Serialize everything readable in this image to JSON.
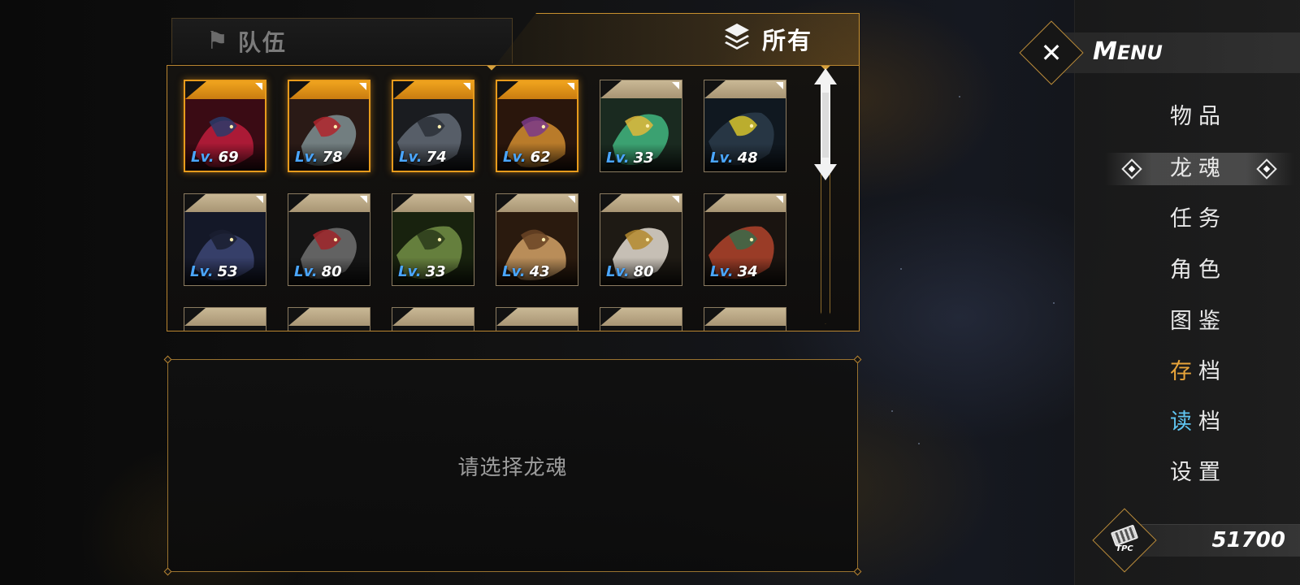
{
  "tabs": {
    "team_label": "队伍",
    "all_label": "所有"
  },
  "dragon_souls": [
    {
      "level_prefix": "Lv.",
      "level": "69",
      "selected": true,
      "colors": [
        "#3a0b14",
        "#b81c3a",
        "#2a3b6a"
      ]
    },
    {
      "level_prefix": "Lv.",
      "level": "78",
      "selected": true,
      "colors": [
        "#2a1a16",
        "#7a8a8c",
        "#b0242c"
      ]
    },
    {
      "level_prefix": "Lv.",
      "level": "74",
      "selected": true,
      "colors": [
        "#1a1c20",
        "#5e6670",
        "#2c3038"
      ]
    },
    {
      "level_prefix": "Lv.",
      "level": "62",
      "selected": true,
      "colors": [
        "#2a160c",
        "#c9862e",
        "#7a3a8a"
      ]
    },
    {
      "level_prefix": "Lv.",
      "level": "33",
      "selected": false,
      "colors": [
        "#1a2a20",
        "#3fae7a",
        "#e2b83a"
      ]
    },
    {
      "level_prefix": "Lv.",
      "level": "48",
      "selected": false,
      "colors": [
        "#101820",
        "#2a3a48",
        "#d6c22a"
      ]
    },
    {
      "level_prefix": "Lv.",
      "level": "53",
      "selected": false,
      "colors": [
        "#141828",
        "#3a4470",
        "#1a1e30"
      ]
    },
    {
      "level_prefix": "Lv.",
      "level": "80",
      "selected": false,
      "colors": [
        "#151515",
        "#6a6a6a",
        "#a0262a"
      ]
    },
    {
      "level_prefix": "Lv.",
      "level": "33",
      "selected": false,
      "colors": [
        "#18220e",
        "#6e8a42",
        "#2a3a1a"
      ]
    },
    {
      "level_prefix": "Lv.",
      "level": "43",
      "selected": false,
      "colors": [
        "#2a1a0e",
        "#c99a62",
        "#6a4424"
      ]
    },
    {
      "level_prefix": "Lv.",
      "level": "80",
      "selected": false,
      "colors": [
        "#1e1a14",
        "#d8d2c6",
        "#b48a2e"
      ]
    },
    {
      "level_prefix": "Lv.",
      "level": "34",
      "selected": false,
      "colors": [
        "#1a1410",
        "#a8402a",
        "#3a6a4a"
      ]
    }
  ],
  "partial_row_count": 6,
  "detail": {
    "hint": "请选择龙魂"
  },
  "menu": {
    "title": "Menu",
    "items": [
      {
        "label": "物品"
      },
      {
        "label": "龙魂",
        "active": true
      },
      {
        "label": "任务"
      },
      {
        "label": "角色"
      },
      {
        "label": "图鉴"
      },
      {
        "label_first": "存",
        "label_rest": "档",
        "first_color": "orange"
      },
      {
        "label_first": "读",
        "label_rest": "档",
        "first_color": "blue"
      },
      {
        "label": "设置"
      }
    ]
  },
  "currency": {
    "icon": "tpc-money-icon",
    "icon_label": "TPC",
    "amount": "51700"
  },
  "colors": {
    "accent_gold": "#c8902e",
    "selected_orange": "#e79b1c",
    "level_blue": "#4aa6ff",
    "save_orange": "#e8a43a",
    "load_blue": "#5fc4f0"
  }
}
